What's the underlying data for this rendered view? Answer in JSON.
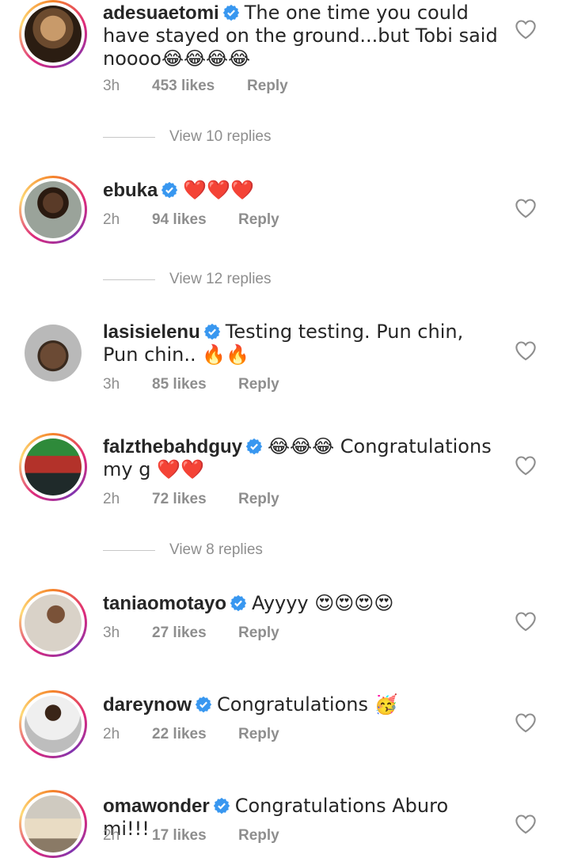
{
  "comments": [
    {
      "username": "adesuaetomi",
      "text": "The one time you could have stayed on the ground...but Tobi said noooo😂😂😂😂",
      "time": "3h",
      "likes": "453 likes",
      "reply": "Reply"
    },
    {
      "username": "ebuka",
      "text": "❤️❤️❤️",
      "time": "2h",
      "likes": "94 likes",
      "reply": "Reply"
    },
    {
      "username": "lasisielenu",
      "text": "Testing testing. Pun chin, Pun chin.. 🔥🔥",
      "time": "3h",
      "likes": "85 likes",
      "reply": "Reply"
    },
    {
      "username": "falzthebahdguy",
      "text": "😂😂😂 Congratulations my g ❤️❤️",
      "time": "2h",
      "likes": "72 likes",
      "reply": "Reply"
    },
    {
      "username": "taniaomotayo",
      "text": "Ayyyy 😍😍😍😍",
      "time": "3h",
      "likes": "27 likes",
      "reply": "Reply"
    },
    {
      "username": "dareynow",
      "text": "Congratulations 🥳",
      "time": "2h",
      "likes": "22 likes",
      "reply": "Reply"
    },
    {
      "username": "omawonder",
      "text": "Congratulations Aburo mi!!!",
      "time": "2h",
      "likes": "17 likes",
      "reply": "Reply"
    }
  ],
  "view_replies": [
    "View 10 replies",
    "View 12 replies",
    "View 8 replies"
  ],
  "colors": {
    "verified": "#3897f0",
    "meta": "#8e8e8e",
    "text": "#262626"
  },
  "icons": {
    "verified": "verified-badge-icon",
    "like": "heart-outline-icon"
  }
}
